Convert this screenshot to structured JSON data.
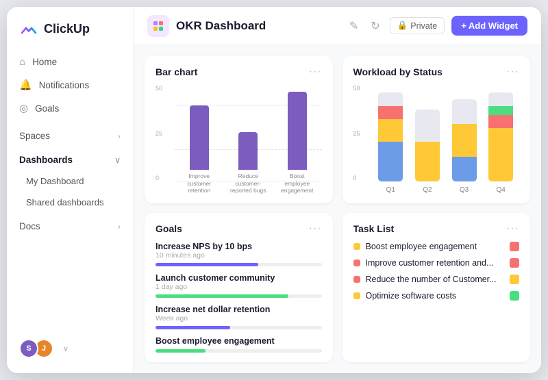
{
  "app": {
    "name": "ClickUp"
  },
  "sidebar": {
    "logo_text": "ClickUp",
    "nav_items": [
      {
        "id": "home",
        "label": "Home",
        "icon": "home"
      },
      {
        "id": "notifications",
        "label": "Notifications",
        "icon": "bell"
      },
      {
        "id": "goals",
        "label": "Goals",
        "icon": "target"
      }
    ],
    "sections": [
      {
        "label": "Spaces",
        "has_arrow": true,
        "items": []
      },
      {
        "label": "Dashboards",
        "has_arrow": true,
        "items": [
          {
            "id": "my-dashboard",
            "label": "My Dashboard"
          },
          {
            "id": "shared-dashboards",
            "label": "Shared dashboards"
          }
        ]
      },
      {
        "label": "Docs",
        "has_arrow": true,
        "items": []
      }
    ],
    "avatar1_initial": "S",
    "avatar2_initial": "J"
  },
  "topbar": {
    "dashboard_title": "OKR Dashboard",
    "private_label": "Private",
    "add_widget_label": "+ Add Widget"
  },
  "bar_chart": {
    "title": "Bar chart",
    "y_labels": [
      "50",
      "25",
      "0"
    ],
    "bars": [
      {
        "label": "Improve customer\nretention",
        "height_pct": 72,
        "color": "#7c5cbf"
      },
      {
        "label": "Reduce customer-\nreported bugs",
        "height_pct": 42,
        "color": "#7c5cbf"
      },
      {
        "label": "Boost employee\nengagement",
        "height_pct": 88,
        "color": "#7c5cbf"
      }
    ]
  },
  "workload_chart": {
    "title": "Workload by Status",
    "y_labels": [
      "50",
      "25",
      "0"
    ],
    "quarters": [
      {
        "label": "Q1",
        "segments": [
          {
            "color": "#6c9be8",
            "pct": 45
          },
          {
            "color": "#ffc837",
            "pct": 25
          },
          {
            "color": "#f87171",
            "pct": 15
          },
          {
            "color": "#e8e8f0",
            "pct": 15
          }
        ]
      },
      {
        "label": "Q2",
        "segments": [
          {
            "color": "#ffc837",
            "pct": 55
          },
          {
            "color": "#e8e8f0",
            "pct": 45
          }
        ]
      },
      {
        "label": "Q3",
        "segments": [
          {
            "color": "#6c9be8",
            "pct": 30
          },
          {
            "color": "#ffc837",
            "pct": 40
          },
          {
            "color": "#e8e8f0",
            "pct": 30
          }
        ]
      },
      {
        "label": "Q4",
        "segments": [
          {
            "color": "#ffc837",
            "pct": 60
          },
          {
            "color": "#f87171",
            "pct": 15
          },
          {
            "color": "#4ade80",
            "pct": 10
          },
          {
            "color": "#e8e8f0",
            "pct": 15
          }
        ]
      }
    ]
  },
  "goals_widget": {
    "title": "Goals",
    "items": [
      {
        "name": "Increase NPS by 10 bps",
        "time": "10 minutes ago",
        "progress": 62,
        "color": "#6c63ff"
      },
      {
        "name": "Launch customer community",
        "time": "1 day ago",
        "progress": 80,
        "color": "#4ade80"
      },
      {
        "name": "Increase net dollar retention",
        "time": "Week ago",
        "progress": 45,
        "color": "#6c63ff"
      },
      {
        "name": "Boost employee engagement",
        "time": "",
        "progress": 30,
        "color": "#4ade80"
      }
    ]
  },
  "task_list_widget": {
    "title": "Task List",
    "items": [
      {
        "name": "Boost employee engagement",
        "dot_color": "#ffc837",
        "flag_color": "#f87171"
      },
      {
        "name": "Improve customer retention and...",
        "dot_color": "#f87171",
        "flag_color": "#f87171"
      },
      {
        "name": "Reduce the number of Customer...",
        "dot_color": "#f87171",
        "flag_color": "#ffc837"
      },
      {
        "name": "Optimize software costs",
        "dot_color": "#ffc837",
        "flag_color": "#4ade80"
      }
    ]
  }
}
